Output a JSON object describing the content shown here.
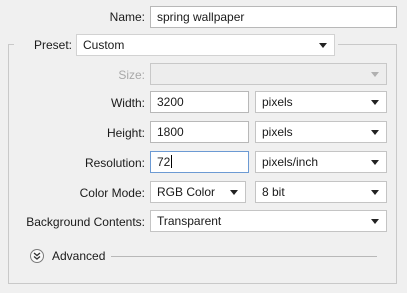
{
  "dialog": {
    "name": {
      "label": "Name:",
      "value": "spring wallpaper"
    },
    "preset": {
      "label": "Preset:",
      "value": "Custom"
    },
    "size": {
      "label": "Size:",
      "value": ""
    },
    "width": {
      "label": "Width:",
      "value": "3200",
      "unit": "pixels"
    },
    "height": {
      "label": "Height:",
      "value": "1800",
      "unit": "pixels"
    },
    "resolution": {
      "label": "Resolution:",
      "value": "72",
      "unit": "pixels/inch"
    },
    "color_mode": {
      "label": "Color Mode:",
      "value": "RGB Color",
      "depth": "8 bit"
    },
    "background": {
      "label": "Background Contents:",
      "value": "Transparent"
    },
    "advanced": {
      "label": "Advanced"
    }
  }
}
